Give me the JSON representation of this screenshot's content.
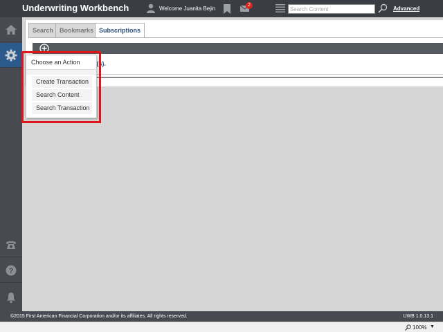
{
  "header": {
    "app_title": "Underwriting Workbench",
    "welcome_text": "Welcome Juanita Bejin",
    "mail_badge_count": "2",
    "search_placeholder": "Search Content",
    "advanced_label": "Advanced"
  },
  "sidebar": {
    "items": [
      {
        "icon": "home-icon"
      },
      {
        "icon": "gear-icon",
        "active": true
      },
      {
        "icon": "phone-icon"
      },
      {
        "icon": "help-icon"
      },
      {
        "icon": "bell-icon"
      }
    ]
  },
  "tabs": [
    {
      "label": "Search"
    },
    {
      "label": "Bookmarks"
    },
    {
      "label": "Subscriptions",
      "active": true
    }
  ],
  "content": {
    "partial_text": "n(s)."
  },
  "action_menu": {
    "title": "Choose an Action",
    "items": [
      "Create Transaction",
      "Search Content",
      "Search Transaction"
    ]
  },
  "footer": {
    "copyright": "©2015 First American Financial Corporation and/or its affiliates. All rights reserved.",
    "version": "UWB 1.0.13.1"
  },
  "statusbar": {
    "zoom": "100%"
  },
  "colors": {
    "header_bg": "#3a3e44",
    "sidebar_bg": "#474b51",
    "active_blue": "#2d5a8c",
    "link_blue": "#2b4d7a",
    "badge_red": "#d9261c",
    "highlight_red": "#e0151a"
  }
}
